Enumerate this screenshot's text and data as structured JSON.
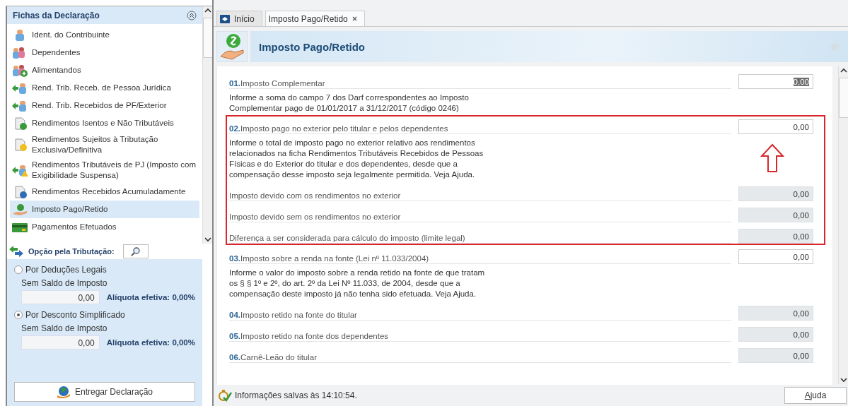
{
  "sidebar": {
    "title": "Fichas da Declaração",
    "items": [
      {
        "label": "Ident. do Contribuinte",
        "kind": "person",
        "selected": false
      },
      {
        "label": "Dependentes",
        "kind": "people",
        "selected": false
      },
      {
        "label": "Alimentandos",
        "kind": "people-plus",
        "selected": false
      },
      {
        "label": "Rend. Trib. Receb. de Pessoa Jurídica",
        "kind": "arrow-person",
        "selected": false
      },
      {
        "label": "Rend. Trib. Recebidos de PF/Exterior",
        "kind": "arrow-person",
        "selected": false
      },
      {
        "label": "Rendimentos Isentos e Não Tributáveis",
        "kind": "doc-check",
        "selected": false
      },
      {
        "label": "Rendimentos Sujeitos à Tributação Exclusiva/Definitiva",
        "kind": "doc-warning",
        "selected": false
      },
      {
        "label": "Rendimentos Tributáveis de PJ (Imposto com Exigibilidade Suspensa)",
        "kind": "arrow-warning",
        "selected": false
      },
      {
        "label": "Rendimentos Recebidos Acumuladamente",
        "kind": "doc-globe",
        "selected": false
      },
      {
        "label": "Imposto Pago/Retido",
        "kind": "money-hand",
        "selected": true
      },
      {
        "label": "Pagamentos Efetuados",
        "kind": "card",
        "selected": false
      }
    ]
  },
  "taxation": {
    "title": "Opção pela Tributação:",
    "options": [
      {
        "label": "Por Deduções Legais",
        "status": "Sem Saldo de Imposto",
        "value": "0,00",
        "rate": "Alíquota efetiva: 0,00%",
        "selected": false
      },
      {
        "label": "Por Desconto Simplificado",
        "status": "Sem Saldo de Imposto",
        "value": "0,00",
        "rate": "Alíquota efetiva: 0,00%",
        "selected": true
      }
    ],
    "submit": "Entregar Declaração"
  },
  "tabs": [
    {
      "label": "Início",
      "closable": false,
      "selected": false
    },
    {
      "label": "Imposto Pago/Retido",
      "closable": true,
      "selected": true
    }
  ],
  "page": {
    "title": "Imposto Pago/Retido"
  },
  "groups": [
    {
      "highlighted": false,
      "fields": [
        {
          "number": "01.",
          "label": "Imposto Complementar",
          "value": "0,00",
          "readonly": false,
          "value_selected": true,
          "description": "Informe a soma do campo 7 dos Darf correspondentes ao Imposto Complementar pago de 01/01/2017 a 31/12/2017 (código 0246)"
        }
      ]
    },
    {
      "highlighted": true,
      "fields": [
        {
          "number": "02.",
          "label": "Imposto pago no exterior pelo titular e pelos dependentes",
          "value": "0,00",
          "readonly": false,
          "value_selected": false,
          "description": "Informe o total de imposto pago no exterior relativo aos rendimentos relacionados na ficha Rendimentos Tributáveis Recebidos de Pessoas Físicas e do Exterior do titular e dos dependentes, desde que a compensação desse imposto seja legalmente permitida. Veja Ajuda."
        },
        {
          "label": "Imposto devido com os rendimentos no exterior",
          "value": "0,00",
          "readonly": true,
          "value_selected": false
        },
        {
          "label": "Imposto devido sem os rendimentos no exterior",
          "value": "0,00",
          "readonly": true,
          "value_selected": false
        },
        {
          "label": "Diferença a ser considerada para cálculo do imposto (limite legal)",
          "value": "0,00",
          "readonly": true,
          "value_selected": false
        }
      ]
    },
    {
      "highlighted": false,
      "fields": [
        {
          "number": "03.",
          "label": "Imposto sobre a renda na fonte (Lei nº 11.033/2004)",
          "value": "0,00",
          "readonly": false,
          "value_selected": false,
          "description": "Informe o valor do imposto sobre a renda retido na fonte de que tratam os § § 1º e 2º, do art. 2º da Lei Nº 11.033, de 2004, desde que a compensação deste imposto já não tenha sido efetuada. Veja Ajuda."
        },
        {
          "number": "04.",
          "label": "Imposto retido na fonte do titular",
          "value": "0,00",
          "readonly": true,
          "value_selected": false
        },
        {
          "number": "05.",
          "label": "Imposto retido na fonte dos dependentes",
          "value": "0,00",
          "readonly": true,
          "value_selected": false
        },
        {
          "number": "06.",
          "label": "Carnê-Leão do titular",
          "value": "0,00",
          "readonly": true,
          "value_selected": false
        }
      ]
    }
  ],
  "status": {
    "message": "Informações salvas às 14:10:54.",
    "help": "Ajuda"
  }
}
